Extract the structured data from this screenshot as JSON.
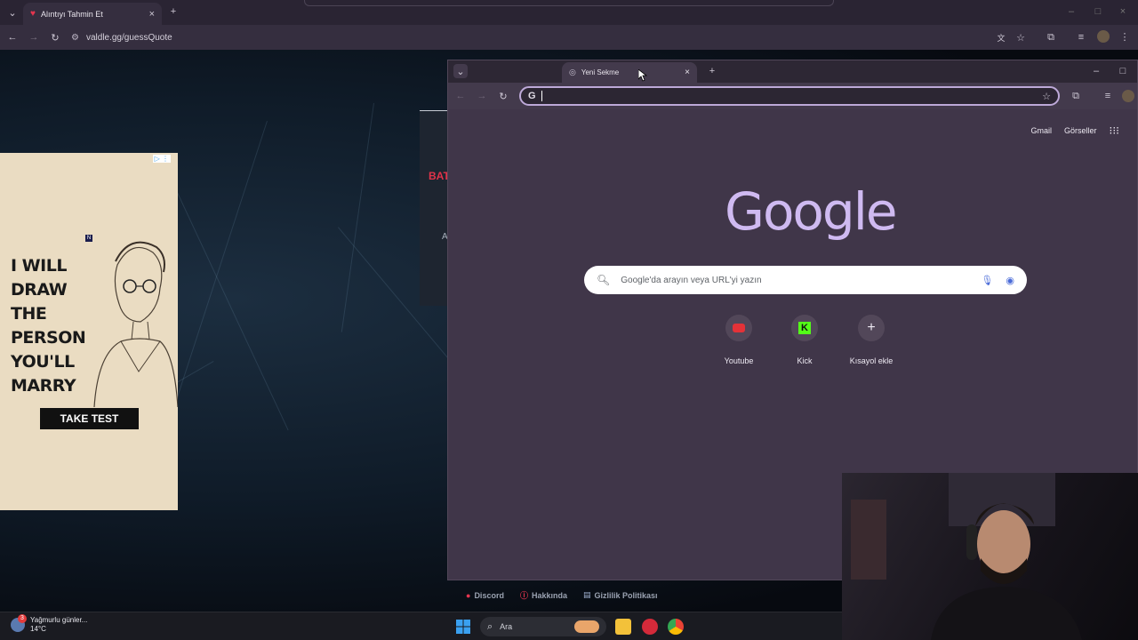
{
  "bg_browser": {
    "tab_title": "Alıntıyı Tahmin Et",
    "url": "valdle.gg/guessQuote"
  },
  "ad": {
    "headline": "I WILL DRAW THE PERSON YOU'LL MARRY",
    "cta": "TAKE TEST"
  },
  "footer": {
    "discord": "Discord",
    "about": "Hakkında",
    "privacy": "Gizlilik Politikası"
  },
  "fg_browser": {
    "tab_title": "Yeni Sekme",
    "gmail": "Gmail",
    "images": "Görseller",
    "logo": "Google",
    "search_placeholder": "Google'da arayın veya URL'yi yazın",
    "shortcuts": [
      {
        "label": "Youtube",
        "color": "#e53238"
      },
      {
        "label": "Kick",
        "color": "#53fc18"
      },
      {
        "label": "Kısayol ekle",
        "color": "#ffffff"
      }
    ]
  },
  "taskbar": {
    "weather_text": "Yağmurlu günler...",
    "temperature": "14°C",
    "weather_badge": "3",
    "search_label": "Ara"
  },
  "colors": {
    "window_bg": "#403649",
    "google_logo": "#cfbaf1",
    "omnibox_focus": "#bda9d8"
  }
}
